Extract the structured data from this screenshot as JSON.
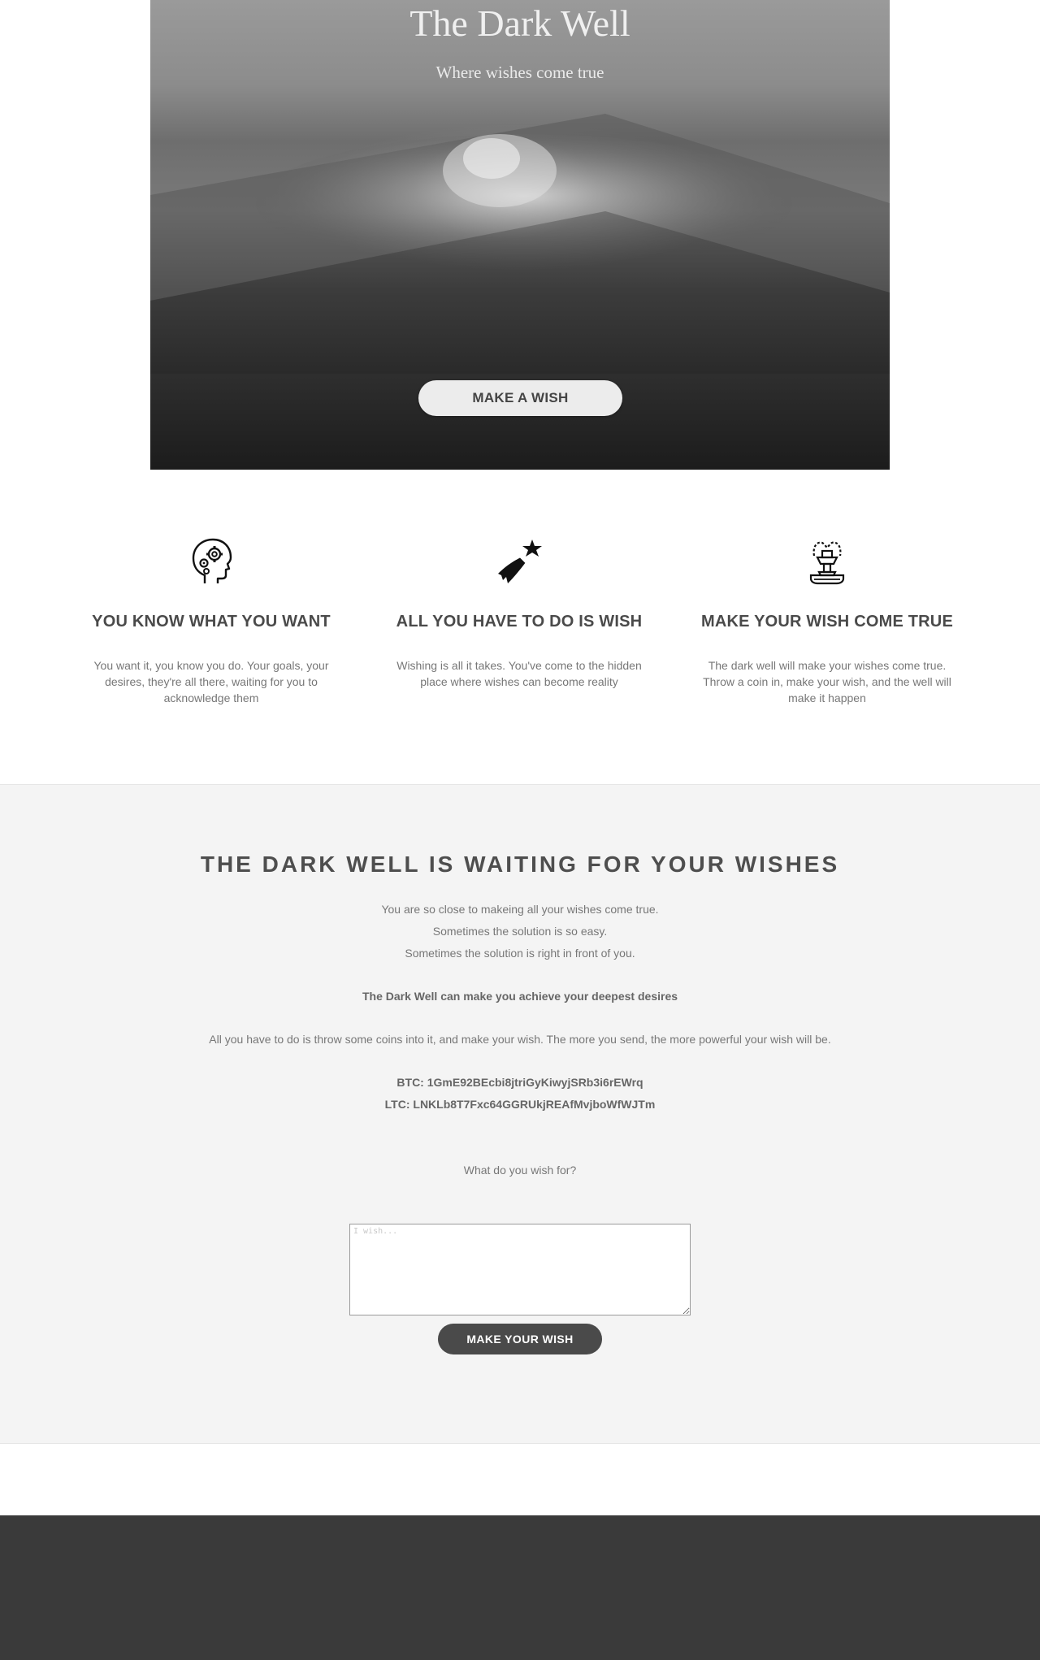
{
  "hero": {
    "title": "The Dark Well",
    "subtitle": "Where wishes come true",
    "cta_label": "MAKE A WISH"
  },
  "features": [
    {
      "icon": "head-gears-icon",
      "title": "YOU KNOW WHAT YOU WANT",
      "text": "You want it, you know you do. Your goals, your desires, they're all there, waiting for you to acknowledge them"
    },
    {
      "icon": "shooting-star-icon",
      "title": "ALL YOU HAVE TO DO IS WISH",
      "text": "Wishing is all it takes. You've come to the hidden place where wishes can become reality"
    },
    {
      "icon": "fountain-icon",
      "title": "MAKE YOUR WISH COME TRUE",
      "text": "The dark well will make your wishes come true. Throw a coin in, make your wish, and the well will make it happen"
    }
  ],
  "waiting": {
    "heading": "THE DARK WELL IS WAITING FOR YOUR WISHES",
    "intro_lines": [
      "You are so close to makeing all your wishes come true.",
      "Sometimes the solution is so easy.",
      "Sometimes the solution is right in front of you."
    ],
    "emphasis": "The Dark Well can make you achieve your deepest desires",
    "instructions": "All you have to do is throw some coins into it, and make your wish. The more you send, the more powerful your wish will be.",
    "btc": "BTC: 1GmE92BEcbi8jtriGyKiwyjSRb3i6rEWrq",
    "ltc": "LTC: LNKLb8T7Fxc64GGRUkjREAfMvjboWfWJTm",
    "prompt": "What do you wish for?",
    "input_placeholder": "I wish...",
    "submit_label": "MAKE YOUR WISH"
  },
  "colors": {
    "hero_button_bg": "#ececec",
    "submit_button_bg": "#4a4a4a",
    "section_bg": "#f4f4f4",
    "footer_bg": "#3a3a3a"
  }
}
